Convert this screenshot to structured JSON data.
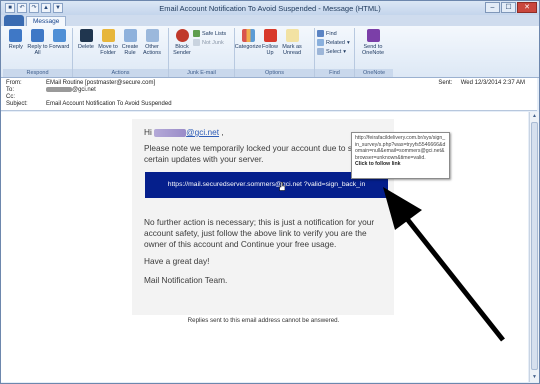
{
  "window": {
    "title": "Email Account Notification To Avoid Suspended - Message (HTML)",
    "tab_label": "Message",
    "controls": [
      "–",
      "☐",
      "✕"
    ]
  },
  "ribbon": {
    "groups": [
      {
        "label": "Respond",
        "buttons": [
          "Reply",
          "Reply to All",
          "Forward"
        ]
      },
      {
        "label": "Actions",
        "buttons": [
          "Delete",
          "Move to Folder",
          "Create Rule",
          "Other Actions"
        ]
      },
      {
        "label": "Junk E-mail",
        "buttons": [
          "Block Sender"
        ],
        "small": [
          "Safe Lists",
          "Not Junk"
        ]
      },
      {
        "label": "Options",
        "buttons": [
          "Categorize",
          "Follow Up",
          "Mark as Unread"
        ]
      },
      {
        "label": "Find",
        "small": [
          "Find",
          "Related",
          "Select"
        ]
      },
      {
        "label": "OneNote",
        "buttons": [
          "Send to OneNote"
        ]
      }
    ]
  },
  "header": {
    "from_label": "From:",
    "from_value": "EMail Routine [postmaster@secure.com]",
    "to_label": "To:",
    "to_value": "@gci.net",
    "cc_label": "Cc:",
    "cc_value": "",
    "subject_label": "Subject:",
    "subject_value": "Email Account Notification To Avoid Suspended",
    "sent_label": "Sent:",
    "sent_value": "Wed 12/3/2014 2:37 AM"
  },
  "message": {
    "greeting_prefix": "Hi",
    "greeting_link": "@gci.net",
    "greeting_suffix": ",",
    "para1": "Please note we temporarily locked your account due to s certain updates with your server.",
    "link_text": "https://mail.securedserver.sommers@gci.net ?valid=sign_back_in",
    "para2": "No further action is necessary; this is just a notification for your account safety, just follow the above link to verify you are the owner of this account and Continue your free usage.",
    "para3": "Have a great day!",
    "signoff": "Mail Notification Team.",
    "footer": "Replies sent to this email address cannot be answered."
  },
  "tooltip": {
    "url": "http://feirafacildelivery.com.br/sys/sign_in_survey/s.php?was=tryyfs5546666&domain=null&email=sommers@gci.net&browser=unknown&time=valid.",
    "hint": "Click to follow link"
  }
}
